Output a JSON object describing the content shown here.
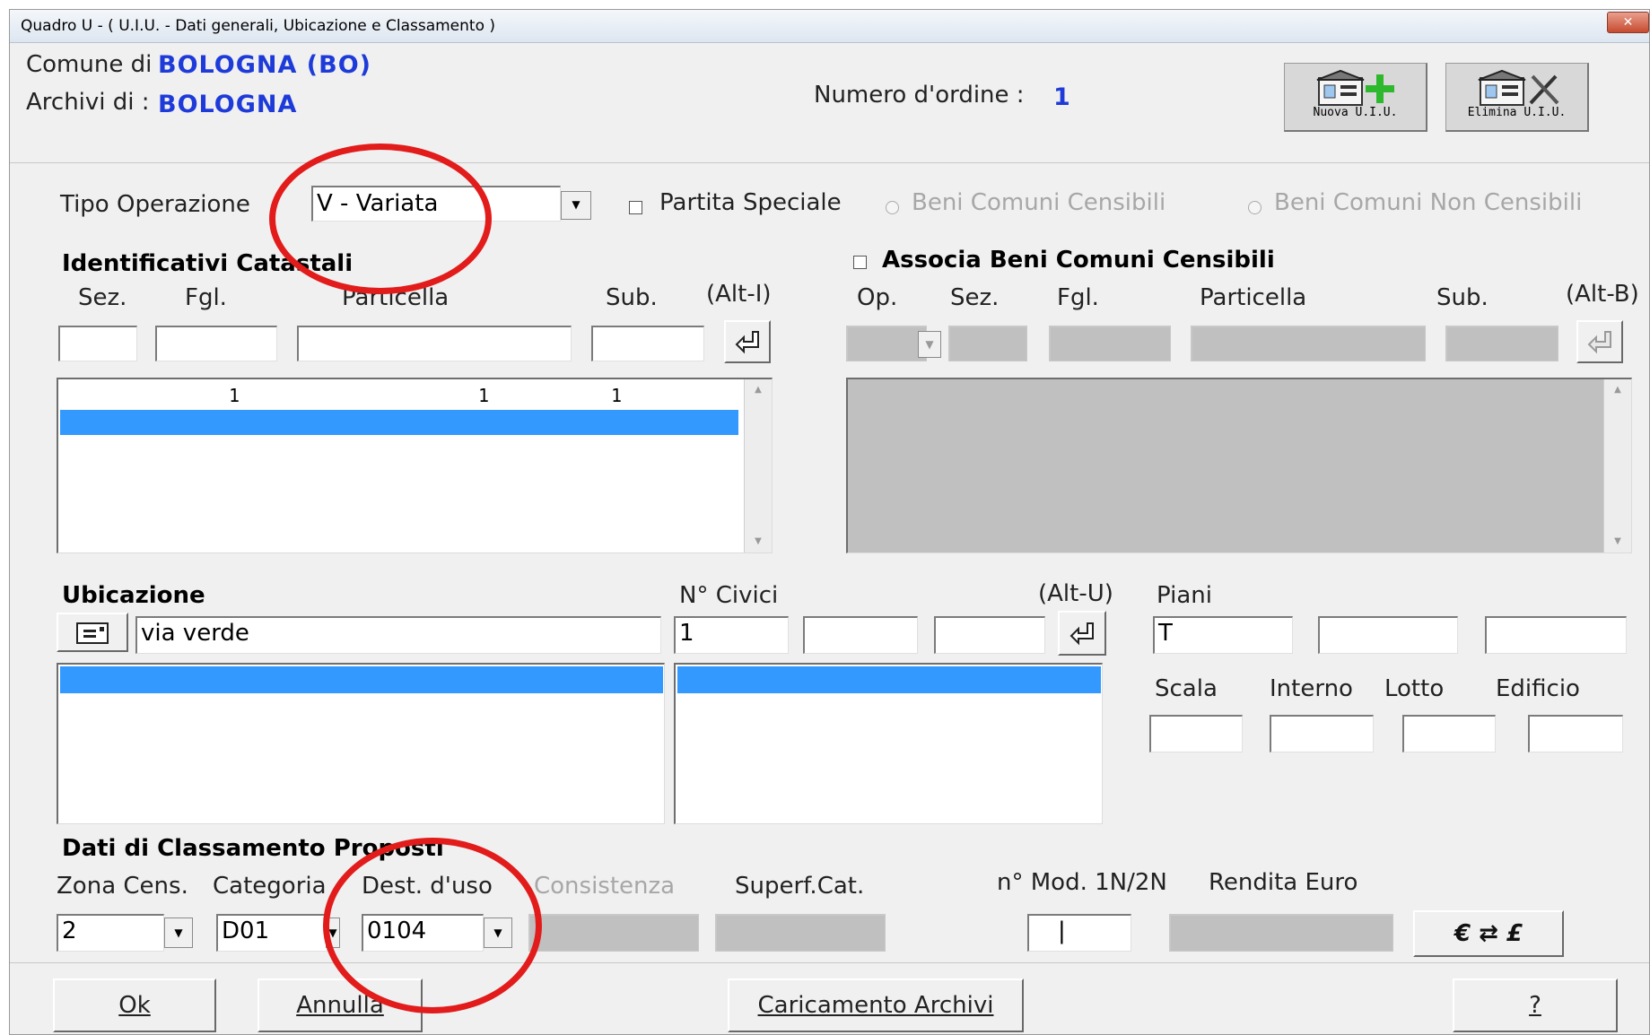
{
  "window": {
    "title": "Quadro U - ( U.I.U. - Dati generali, Ubicazione e Classamento )",
    "close_label": "✕"
  },
  "header": {
    "comune_label": "Comune di  :",
    "comune_value": "BOLOGNA (BO)",
    "archivi_label": "Archivi di   :",
    "archivi_value": "BOLOGNA",
    "numero_ordine_label": "Numero d'ordine :",
    "numero_ordine_value": "1",
    "nuova_uiu_label": "Nuova U.I.U.",
    "elimina_uiu_label": "Elimina U.I.U."
  },
  "tipo_operazione": {
    "label": "Tipo Operazione",
    "value": "V - Variata",
    "partita_speciale_label": "Partita Speciale",
    "beni_censibili_label": "Beni Comuni Censibili",
    "beni_non_censibili_label": "Beni Comuni Non Censibili"
  },
  "identificativi": {
    "title": "Identificativi Catastali",
    "col_sez": "Sez.",
    "col_fgl": "Fgl.",
    "col_particella": "Particella",
    "col_sub": "Sub.",
    "shortcut": "(Alt-I)",
    "rows": [
      {
        "sez": "",
        "fgl": "1",
        "particella": "1",
        "sub": "1"
      }
    ]
  },
  "beni_comuni": {
    "title": "Associa Beni Comuni Censibili",
    "col_op": "Op.",
    "col_sez": "Sez.",
    "col_fgl": "Fgl.",
    "col_particella": "Particella",
    "col_sub": "Sub.",
    "shortcut": "(Alt-B)"
  },
  "ubicazione": {
    "title": "Ubicazione",
    "civici_label": "N° Civici",
    "shortcut": "(Alt-U)",
    "piani_label": "Piani",
    "via_value": "via verde",
    "civico1": "1",
    "piano1": "T",
    "scala_label": "Scala",
    "interno_label": "Interno",
    "lotto_label": "Lotto",
    "edificio_label": "Edificio"
  },
  "classamento": {
    "title": "Dati di Classamento Proposti",
    "zona_label": "Zona Cens.",
    "categoria_label": "Categoria",
    "dest_uso_label": "Dest. d'uso",
    "consistenza_label": "Consistenza",
    "superf_label": "Superf.Cat.",
    "mod_label": "n° Mod. 1N/2N",
    "rendita_label": "Rendita  Euro",
    "zona_value": "2",
    "categoria_value": "D01",
    "dest_uso_value": "0104",
    "mod_value": "|",
    "convert_label": "€ ⇄ £"
  },
  "footer": {
    "ok_label": "Ok",
    "annulla_label": "Annulla",
    "caricamento_label": "Caricamento Archivi",
    "help_label": "?"
  },
  "colors": {
    "accent_blue": "#1e3bd9",
    "selection": "#3399ff",
    "annotation_red": "#e21b1b"
  }
}
